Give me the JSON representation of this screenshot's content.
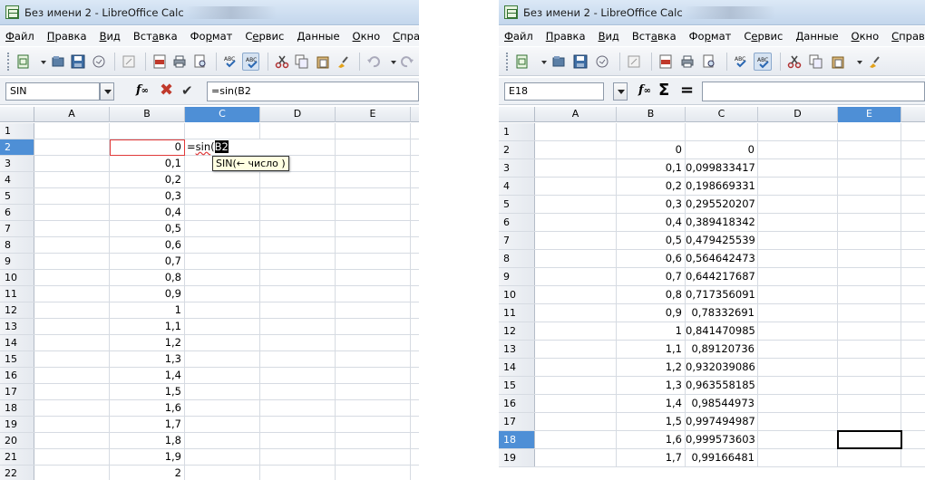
{
  "left": {
    "title": "Без имени 2 - LibreOffice Calc",
    "menu": [
      {
        "u": "Ф",
        "rest": "айл"
      },
      {
        "u": "П",
        "rest": "равка"
      },
      {
        "u": "В",
        "rest": "ид"
      },
      {
        "u": "",
        "pre": "Вст",
        "uc": "а",
        "rest": "вка"
      },
      {
        "u": "",
        "pre": "Фо",
        "uc": "р",
        "rest": "мат"
      },
      {
        "u": "",
        "pre": "С",
        "uc": "е",
        "rest": "рвис"
      },
      {
        "u": "Д",
        "rest": "анные"
      },
      {
        "u": "О",
        "rest": "кно"
      },
      {
        "u": "С",
        "rest": "правка"
      }
    ],
    "namebox": "SIN",
    "formula": "=sin(B2",
    "columns": [
      "A",
      "B",
      "C",
      "D",
      "E"
    ],
    "active_column": "C",
    "active_row": "2",
    "rows": [
      {
        "n": "1",
        "b": ""
      },
      {
        "n": "2",
        "b": "0"
      },
      {
        "n": "3",
        "b": "0,1"
      },
      {
        "n": "4",
        "b": "0,2"
      },
      {
        "n": "5",
        "b": "0,3"
      },
      {
        "n": "6",
        "b": "0,4"
      },
      {
        "n": "7",
        "b": "0,5"
      },
      {
        "n": "8",
        "b": "0,6"
      },
      {
        "n": "9",
        "b": "0,7"
      },
      {
        "n": "10",
        "b": "0,8"
      },
      {
        "n": "11",
        "b": "0,9"
      },
      {
        "n": "12",
        "b": "1"
      },
      {
        "n": "13",
        "b": "1,1"
      },
      {
        "n": "14",
        "b": "1,2"
      },
      {
        "n": "15",
        "b": "1,3"
      },
      {
        "n": "16",
        "b": "1,4"
      },
      {
        "n": "17",
        "b": "1,5"
      },
      {
        "n": "18",
        "b": "1,6"
      },
      {
        "n": "19",
        "b": "1,7"
      },
      {
        "n": "20",
        "b": "1,8"
      },
      {
        "n": "21",
        "b": "1,9"
      },
      {
        "n": "22",
        "b": "2"
      }
    ],
    "edit_cell": {
      "prefix": "=",
      "func": "sin",
      "paren": "(",
      "ref": "B2"
    },
    "tooltip": "SIN(← число )"
  },
  "right": {
    "title": "Без имени 2 - LibreOffice Calc",
    "menu": [
      {
        "u": "Ф",
        "rest": "айл"
      },
      {
        "u": "П",
        "rest": "равка"
      },
      {
        "u": "В",
        "rest": "ид"
      },
      {
        "u": "",
        "pre": "Вст",
        "uc": "а",
        "rest": "вка"
      },
      {
        "u": "",
        "pre": "Фо",
        "uc": "р",
        "rest": "мат"
      },
      {
        "u": "",
        "pre": "С",
        "uc": "е",
        "rest": "рвис"
      },
      {
        "u": "Д",
        "rest": "анные"
      },
      {
        "u": "О",
        "rest": "кно"
      },
      {
        "u": "С",
        "rest": "прав"
      }
    ],
    "namebox": "E18",
    "formula": "",
    "columns": [
      "A",
      "B",
      "C",
      "D",
      "E"
    ],
    "active_column": "E",
    "active_row": "18",
    "rows": [
      {
        "n": "1",
        "b": "",
        "c": ""
      },
      {
        "n": "2",
        "b": "0",
        "c": "0"
      },
      {
        "n": "3",
        "b": "0,1",
        "c": "0,099833417"
      },
      {
        "n": "4",
        "b": "0,2",
        "c": "0,198669331"
      },
      {
        "n": "5",
        "b": "0,3",
        "c": "0,295520207"
      },
      {
        "n": "6",
        "b": "0,4",
        "c": "0,389418342"
      },
      {
        "n": "7",
        "b": "0,5",
        "c": "0,479425539"
      },
      {
        "n": "8",
        "b": "0,6",
        "c": "0,564642473"
      },
      {
        "n": "9",
        "b": "0,7",
        "c": "0,644217687"
      },
      {
        "n": "10",
        "b": "0,8",
        "c": "0,717356091"
      },
      {
        "n": "11",
        "b": "0,9",
        "c": "0,78332691"
      },
      {
        "n": "12",
        "b": "1",
        "c": "0,841470985"
      },
      {
        "n": "13",
        "b": "1,1",
        "c": "0,89120736"
      },
      {
        "n": "14",
        "b": "1,2",
        "c": "0,932039086"
      },
      {
        "n": "15",
        "b": "1,3",
        "c": "0,963558185"
      },
      {
        "n": "16",
        "b": "1,4",
        "c": "0,98544973"
      },
      {
        "n": "17",
        "b": "1,5",
        "c": "0,997494987"
      },
      {
        "n": "18",
        "b": "1,6",
        "c": "0,999573603"
      },
      {
        "n": "19",
        "b": "1,7",
        "c": "0,99166481"
      }
    ]
  },
  "colors": {
    "active_header": "#4e8fd6",
    "ref_border": "#e03a3a",
    "tooltip_bg": "#ffffe1"
  }
}
